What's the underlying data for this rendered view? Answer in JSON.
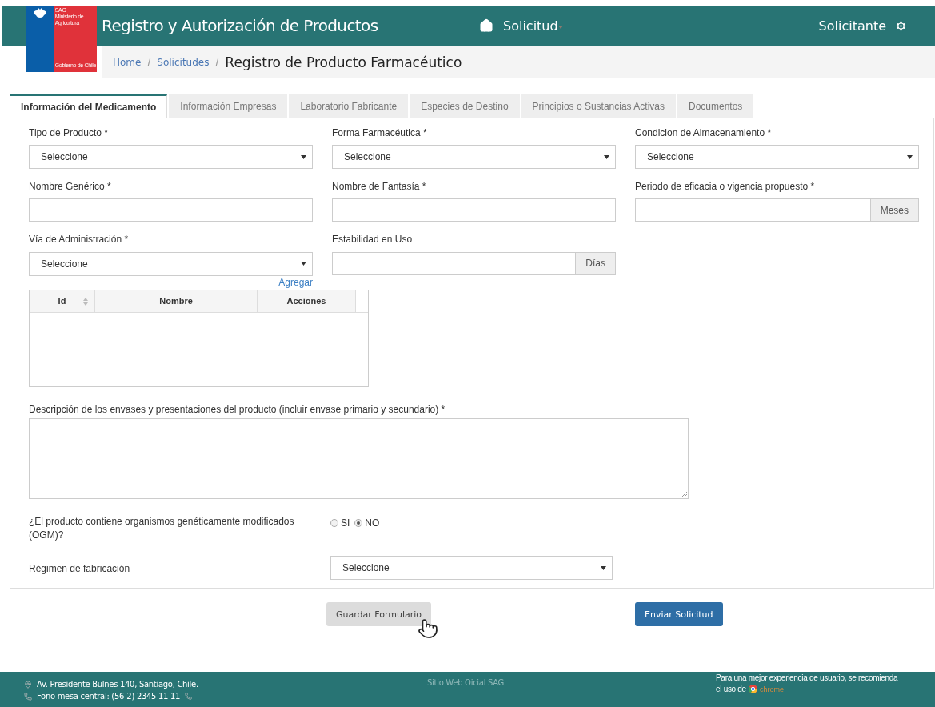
{
  "header": {
    "logo": {
      "acronym": "SAG",
      "ministry": "Ministerio de Agricultura",
      "government": "Gobierno de Chile"
    },
    "title": "Registro y Autorización de Productos",
    "nav": [
      {
        "label": "Solicitud",
        "dropdown": true
      }
    ],
    "user": "Solicitante"
  },
  "breadcrumb": {
    "links": [
      "Home",
      "Solicitudes"
    ],
    "separator": "/",
    "current": "Registro de Producto Farmacéutico"
  },
  "tabs": [
    {
      "label": "Información del Medicamento",
      "selected": true
    },
    {
      "label": "Información Empresas",
      "selected": false
    },
    {
      "label": "Laboratorio Fabricante",
      "selected": false
    },
    {
      "label": "Especies de Destino",
      "selected": false
    },
    {
      "label": "Principios o Sustancias Activas",
      "selected": false
    },
    {
      "label": "Documentos",
      "selected": false
    }
  ],
  "field_rows": [
    [
      {
        "kind": "select",
        "label": "Tipo de Producto *",
        "value": "Seleccione"
      },
      {
        "kind": "select",
        "label": "Forma Farmacéutica *",
        "value": "Seleccione"
      },
      {
        "kind": "select",
        "label": "Condicion de Almacenamiento *",
        "value": "Seleccione"
      }
    ],
    [
      {
        "kind": "text",
        "label": "Nombre Genérico *"
      },
      {
        "kind": "text",
        "label": "Nombre de Fantasía *"
      },
      {
        "kind": "addon",
        "label": "Periodo de eficacia o vigencia propuesto *",
        "addon": "Meses"
      }
    ],
    [
      {
        "kind": "select",
        "label": "Vía de Administración *",
        "value": "Seleccione",
        "link": "Agregar"
      },
      {
        "kind": "addon",
        "label": "Estabilidad en Uso",
        "addon": "Días"
      }
    ]
  ],
  "table": {
    "columns": [
      {
        "label": "Id",
        "sortable": true
      },
      {
        "label": "Nombre",
        "sortable": false
      },
      {
        "label": "Acciones",
        "sortable": false
      }
    ]
  },
  "description": {
    "label": "Descripción de los envases y presentaciones del producto (incluir envase primario y secundario) *"
  },
  "ogm": {
    "label": "¿El producto contiene organismos genéticamente modificados (OGM)?",
    "options": [
      {
        "label": "SI",
        "selected": false
      },
      {
        "label": "NO",
        "selected": true
      }
    ]
  },
  "regimen": {
    "label": "Régimen de fabricación",
    "value": "Seleccione"
  },
  "buttons": [
    {
      "label": "Guardar Formulario",
      "kind": "secondary"
    },
    {
      "label": "Enviar Solicitud",
      "kind": "primary"
    }
  ],
  "footer": {
    "address": "Av. Presidente Bulnes 140, Santiago, Chile.",
    "phone": "Fono mesa central: (56-2) 2345 11 11",
    "center": "Sitio Web Oicial SAG",
    "recommendation": [
      "Para una mejor experiencia de usuario, se recomienda",
      "el uso de"
    ],
    "browser": "chrome"
  }
}
